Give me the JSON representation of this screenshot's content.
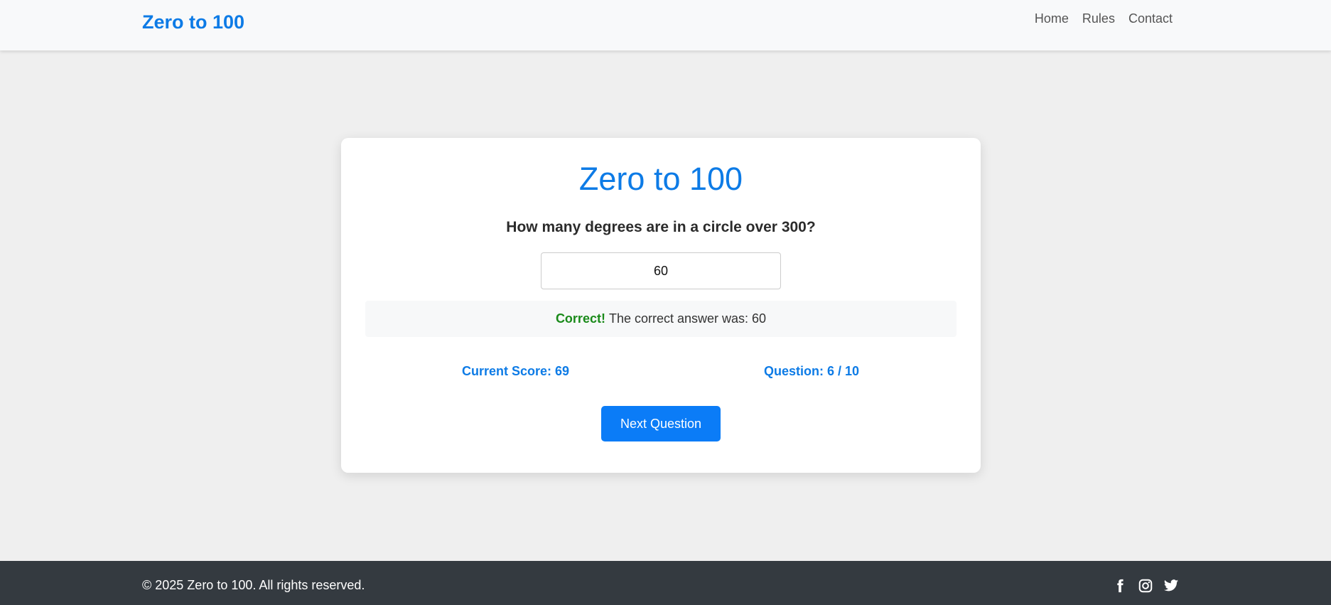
{
  "navbar": {
    "brand": "Zero to 100",
    "links": [
      "Home",
      "Rules",
      "Contact"
    ]
  },
  "quiz": {
    "title": "Zero to 100",
    "question": "How many degrees are in a circle over 300?",
    "answer_value": "60",
    "feedback_status": "Correct!",
    "feedback_message": "The correct answer was: 60",
    "score": "Current Score: 69",
    "question_count": "Question: 6 / 10",
    "next_button_label": "Next Question"
  },
  "footer": {
    "copyright": "© 2025 Zero to 100. All rights reserved.",
    "social_icons": [
      "facebook-icon",
      "instagram-icon",
      "twitter-icon"
    ]
  },
  "colors": {
    "accent": "#0d7be6",
    "button": "#0b7cf7",
    "correct": "#1a8a1a",
    "footer_bg": "#343a40",
    "page_bg": "#efefef"
  }
}
